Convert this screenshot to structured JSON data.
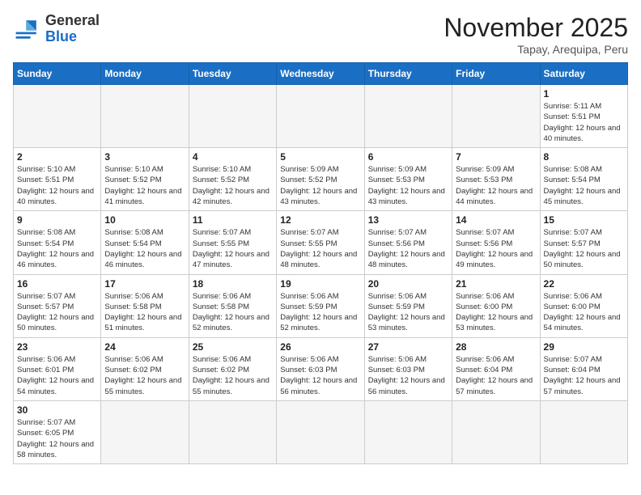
{
  "header": {
    "logo_general": "General",
    "logo_blue": "Blue",
    "month_title": "November 2025",
    "location": "Tapay, Arequipa, Peru"
  },
  "days_of_week": [
    "Sunday",
    "Monday",
    "Tuesday",
    "Wednesday",
    "Thursday",
    "Friday",
    "Saturday"
  ],
  "weeks": [
    [
      {
        "day": "",
        "info": ""
      },
      {
        "day": "",
        "info": ""
      },
      {
        "day": "",
        "info": ""
      },
      {
        "day": "",
        "info": ""
      },
      {
        "day": "",
        "info": ""
      },
      {
        "day": "",
        "info": ""
      },
      {
        "day": "1",
        "info": "Sunrise: 5:11 AM\nSunset: 5:51 PM\nDaylight: 12 hours and 40 minutes."
      }
    ],
    [
      {
        "day": "2",
        "info": "Sunrise: 5:10 AM\nSunset: 5:51 PM\nDaylight: 12 hours and 40 minutes."
      },
      {
        "day": "3",
        "info": "Sunrise: 5:10 AM\nSunset: 5:52 PM\nDaylight: 12 hours and 41 minutes."
      },
      {
        "day": "4",
        "info": "Sunrise: 5:10 AM\nSunset: 5:52 PM\nDaylight: 12 hours and 42 minutes."
      },
      {
        "day": "5",
        "info": "Sunrise: 5:09 AM\nSunset: 5:52 PM\nDaylight: 12 hours and 43 minutes."
      },
      {
        "day": "6",
        "info": "Sunrise: 5:09 AM\nSunset: 5:53 PM\nDaylight: 12 hours and 43 minutes."
      },
      {
        "day": "7",
        "info": "Sunrise: 5:09 AM\nSunset: 5:53 PM\nDaylight: 12 hours and 44 minutes."
      },
      {
        "day": "8",
        "info": "Sunrise: 5:08 AM\nSunset: 5:54 PM\nDaylight: 12 hours and 45 minutes."
      }
    ],
    [
      {
        "day": "9",
        "info": "Sunrise: 5:08 AM\nSunset: 5:54 PM\nDaylight: 12 hours and 46 minutes."
      },
      {
        "day": "10",
        "info": "Sunrise: 5:08 AM\nSunset: 5:54 PM\nDaylight: 12 hours and 46 minutes."
      },
      {
        "day": "11",
        "info": "Sunrise: 5:07 AM\nSunset: 5:55 PM\nDaylight: 12 hours and 47 minutes."
      },
      {
        "day": "12",
        "info": "Sunrise: 5:07 AM\nSunset: 5:55 PM\nDaylight: 12 hours and 48 minutes."
      },
      {
        "day": "13",
        "info": "Sunrise: 5:07 AM\nSunset: 5:56 PM\nDaylight: 12 hours and 48 minutes."
      },
      {
        "day": "14",
        "info": "Sunrise: 5:07 AM\nSunset: 5:56 PM\nDaylight: 12 hours and 49 minutes."
      },
      {
        "day": "15",
        "info": "Sunrise: 5:07 AM\nSunset: 5:57 PM\nDaylight: 12 hours and 50 minutes."
      }
    ],
    [
      {
        "day": "16",
        "info": "Sunrise: 5:07 AM\nSunset: 5:57 PM\nDaylight: 12 hours and 50 minutes."
      },
      {
        "day": "17",
        "info": "Sunrise: 5:06 AM\nSunset: 5:58 PM\nDaylight: 12 hours and 51 minutes."
      },
      {
        "day": "18",
        "info": "Sunrise: 5:06 AM\nSunset: 5:58 PM\nDaylight: 12 hours and 52 minutes."
      },
      {
        "day": "19",
        "info": "Sunrise: 5:06 AM\nSunset: 5:59 PM\nDaylight: 12 hours and 52 minutes."
      },
      {
        "day": "20",
        "info": "Sunrise: 5:06 AM\nSunset: 5:59 PM\nDaylight: 12 hours and 53 minutes."
      },
      {
        "day": "21",
        "info": "Sunrise: 5:06 AM\nSunset: 6:00 PM\nDaylight: 12 hours and 53 minutes."
      },
      {
        "day": "22",
        "info": "Sunrise: 5:06 AM\nSunset: 6:00 PM\nDaylight: 12 hours and 54 minutes."
      }
    ],
    [
      {
        "day": "23",
        "info": "Sunrise: 5:06 AM\nSunset: 6:01 PM\nDaylight: 12 hours and 54 minutes."
      },
      {
        "day": "24",
        "info": "Sunrise: 5:06 AM\nSunset: 6:02 PM\nDaylight: 12 hours and 55 minutes."
      },
      {
        "day": "25",
        "info": "Sunrise: 5:06 AM\nSunset: 6:02 PM\nDaylight: 12 hours and 55 minutes."
      },
      {
        "day": "26",
        "info": "Sunrise: 5:06 AM\nSunset: 6:03 PM\nDaylight: 12 hours and 56 minutes."
      },
      {
        "day": "27",
        "info": "Sunrise: 5:06 AM\nSunset: 6:03 PM\nDaylight: 12 hours and 56 minutes."
      },
      {
        "day": "28",
        "info": "Sunrise: 5:06 AM\nSunset: 6:04 PM\nDaylight: 12 hours and 57 minutes."
      },
      {
        "day": "29",
        "info": "Sunrise: 5:07 AM\nSunset: 6:04 PM\nDaylight: 12 hours and 57 minutes."
      }
    ],
    [
      {
        "day": "30",
        "info": "Sunrise: 5:07 AM\nSunset: 6:05 PM\nDaylight: 12 hours and 58 minutes."
      },
      {
        "day": "",
        "info": ""
      },
      {
        "day": "",
        "info": ""
      },
      {
        "day": "",
        "info": ""
      },
      {
        "day": "",
        "info": ""
      },
      {
        "day": "",
        "info": ""
      },
      {
        "day": "",
        "info": ""
      }
    ]
  ]
}
